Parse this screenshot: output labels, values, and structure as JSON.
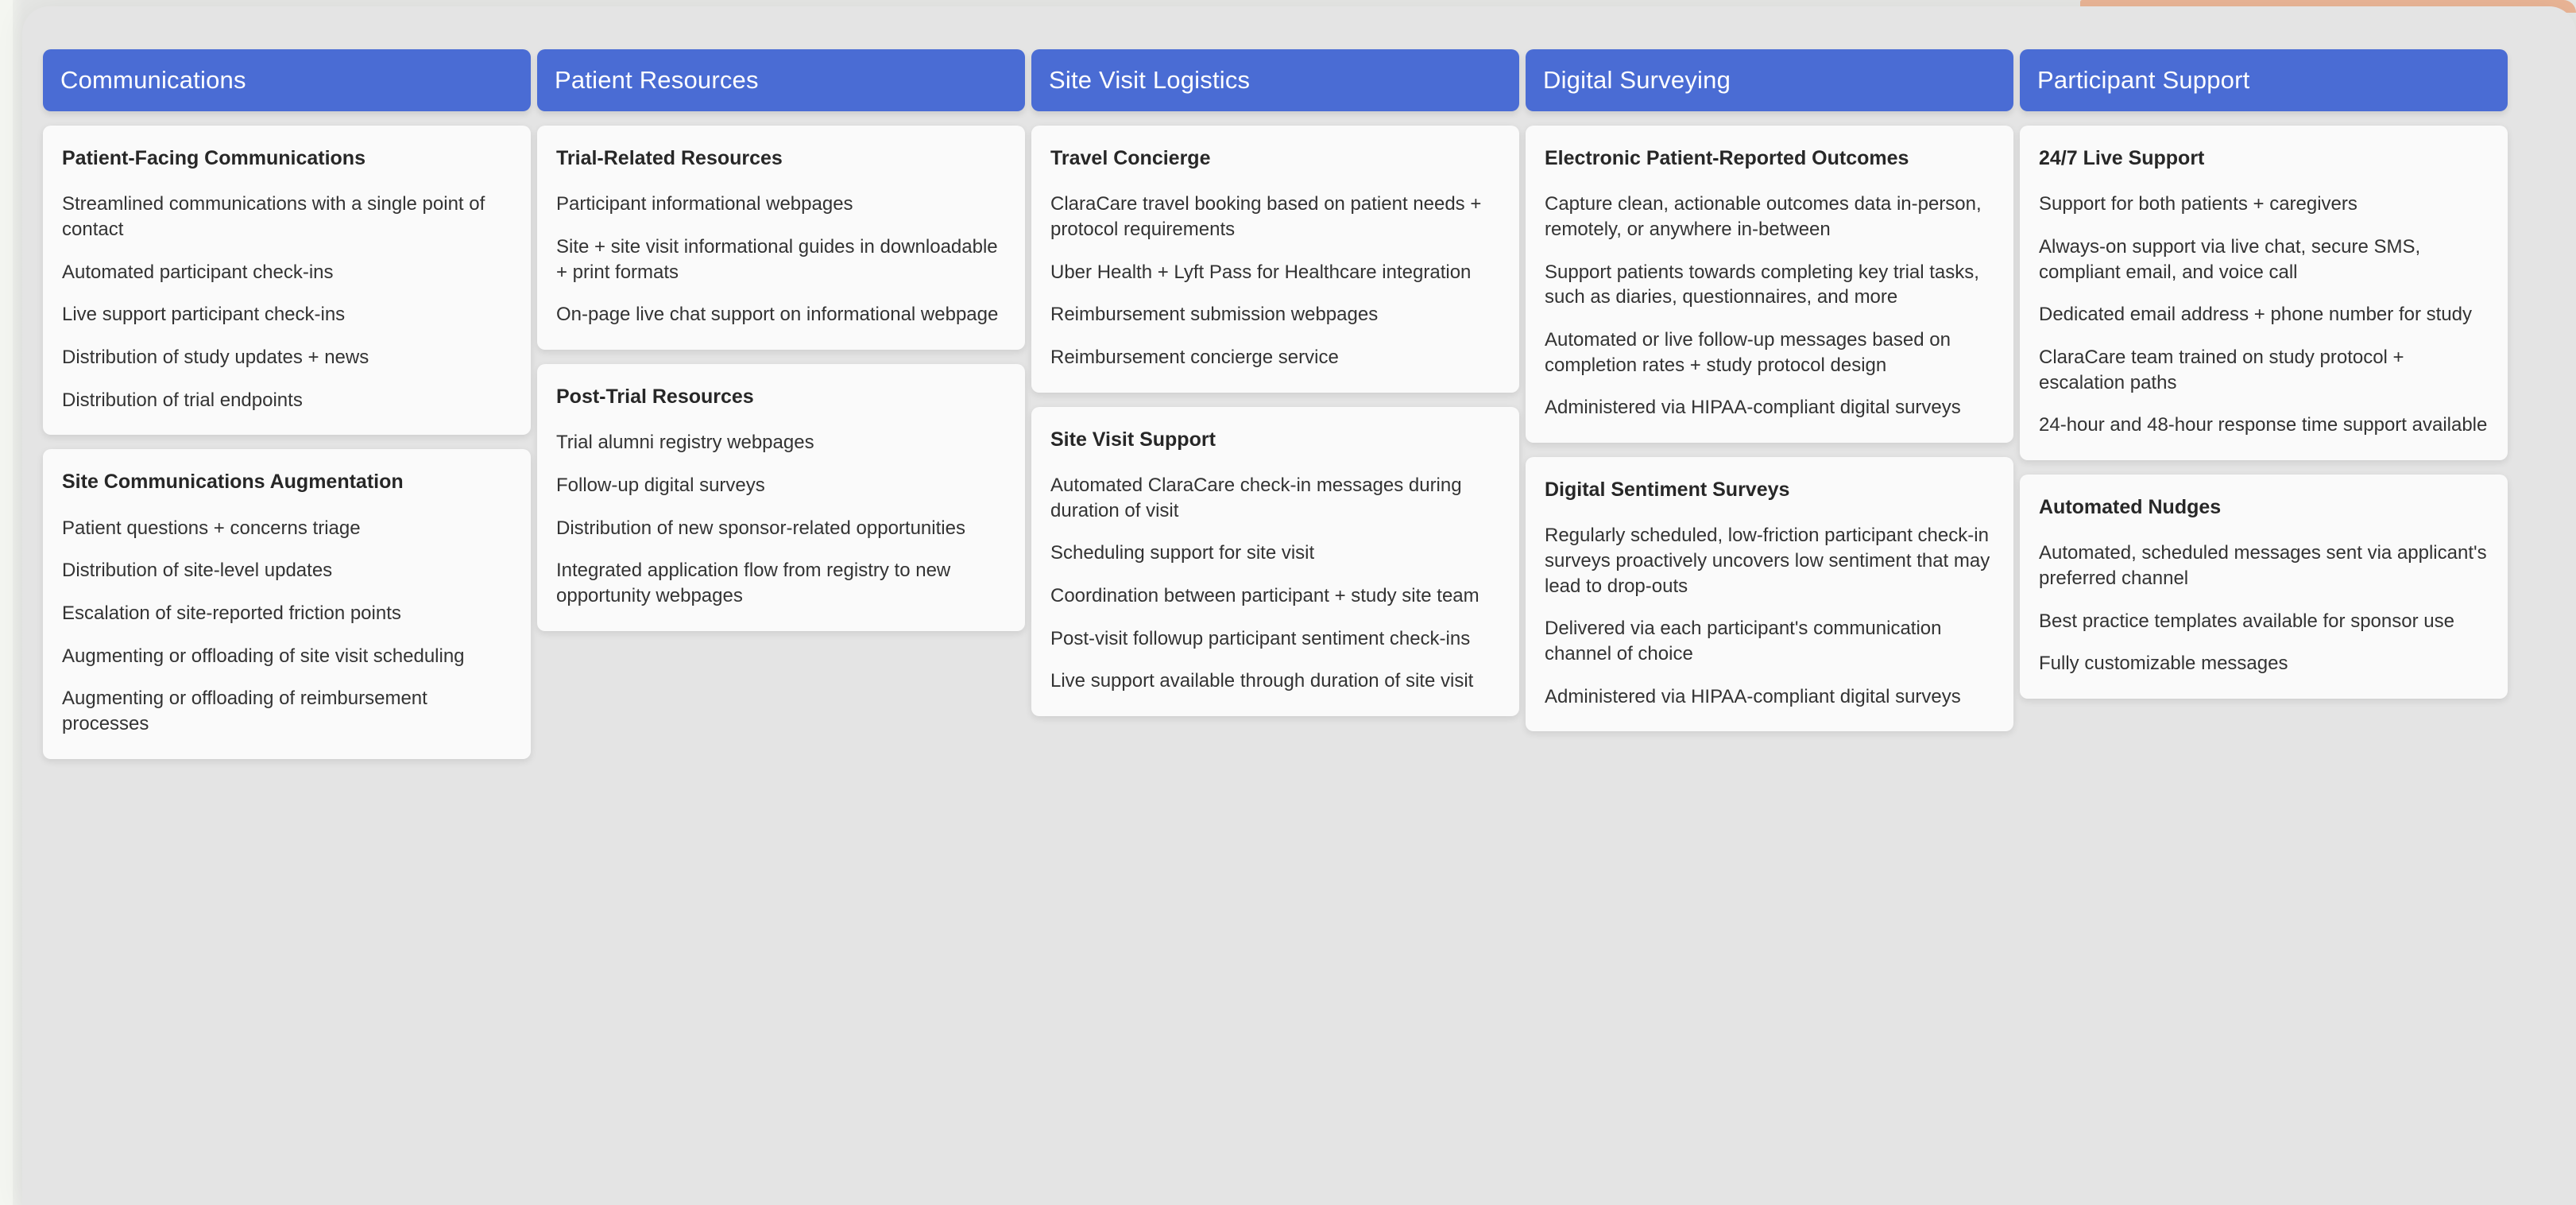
{
  "accent_colors": {
    "header_blue": "#4a6cd4",
    "board_grey": "#e4e4e4",
    "card_white": "#fafafa",
    "peach_bar": "#eab596",
    "page_background": "#f2f4ef"
  },
  "columns": [
    {
      "header": "Communications",
      "cards": [
        {
          "title": "Patient-Facing Communications",
          "items": [
            "Streamlined communications with a single point of contact",
            "Automated participant check-ins",
            "Live support participant check-ins",
            "Distribution of study updates + news",
            "Distribution of trial endpoints"
          ]
        },
        {
          "title": "Site Communications Augmentation",
          "items": [
            "Patient questions + concerns triage",
            "Distribution of site-level updates",
            "Escalation of site-reported friction points",
            "Augmenting or offloading of site visit scheduling",
            "Augmenting or offloading of reimbursement processes"
          ]
        }
      ]
    },
    {
      "header": "Patient Resources",
      "cards": [
        {
          "title": "Trial-Related Resources",
          "items": [
            "Participant informational webpages",
            "Site + site visit informational guides in downloadable + print formats",
            "On-page live chat support on informational webpage"
          ]
        },
        {
          "title": "Post-Trial Resources",
          "items": [
            "Trial alumni registry webpages",
            "Follow-up digital surveys",
            "Distribution of new sponsor-related opportunities",
            "Integrated application flow from registry to new opportunity webpages"
          ]
        }
      ]
    },
    {
      "header": "Site Visit Logistics",
      "cards": [
        {
          "title": "Travel Concierge",
          "items": [
            "ClaraCare travel booking based on patient needs + protocol requirements",
            "Uber Health + Lyft Pass for Healthcare integration",
            "Reimbursement submission webpages",
            "Reimbursement concierge service"
          ]
        },
        {
          "title": "Site Visit Support",
          "items": [
            "Automated ClaraCare check-in messages during duration of visit",
            "Scheduling support for site visit",
            "Coordination between participant + study site team",
            "Post-visit followup participant sentiment check-ins",
            "Live support available through duration of site visit"
          ]
        }
      ]
    },
    {
      "header": "Digital Surveying",
      "cards": [
        {
          "title": "Electronic Patient-Reported Outcomes",
          "items": [
            "Capture clean, actionable outcomes data in-person, remotely, or anywhere in-between",
            "Support patients towards completing key trial tasks, such as diaries, questionnaires, and more",
            "Automated or live follow-up messages based on completion rates + study protocol design",
            "Administered via HIPAA-compliant digital surveys"
          ]
        },
        {
          "title": "Digital Sentiment Surveys",
          "items": [
            "Regularly scheduled, low-friction participant check-in surveys proactively uncovers low sentiment that may lead to drop-outs",
            "Delivered via each participant's communication channel of choice",
            "Administered via HIPAA-compliant digital surveys"
          ]
        }
      ]
    },
    {
      "header": "Participant Support",
      "cards": [
        {
          "title": "24/7 Live Support",
          "items": [
            "Support for both patients + caregivers",
            "Always-on support via live chat, secure SMS, compliant email, and voice call",
            "Dedicated email address + phone number for study",
            "ClaraCare team trained on study protocol + escalation paths",
            "24-hour and 48-hour response time support available"
          ]
        },
        {
          "title": "Automated Nudges",
          "items": [
            "Automated, scheduled messages sent via applicant's preferred channel",
            "Best practice templates available for sponsor use",
            "Fully customizable messages"
          ]
        }
      ]
    }
  ]
}
